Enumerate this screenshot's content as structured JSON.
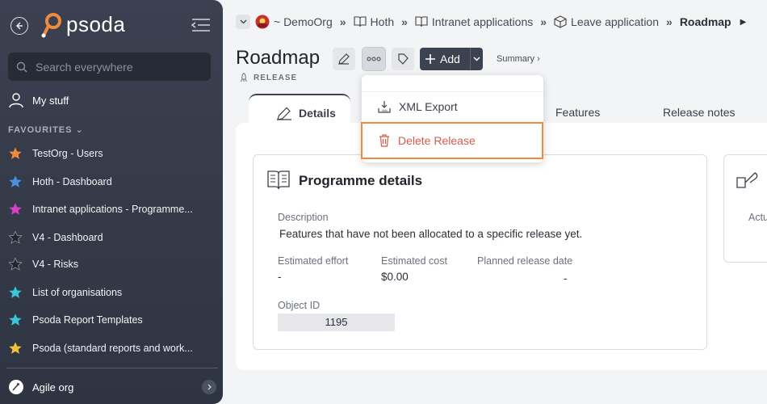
{
  "sidebar": {
    "logo_text": "psoda",
    "search_placeholder": "Search everywhere",
    "my_stuff": "My stuff",
    "favourites_heading": "FAVOURITES",
    "items": [
      {
        "label": "TestOrg - Users",
        "color": "#f08a3c"
      },
      {
        "label": "Hoth - Dashboard",
        "color": "#4a90e2"
      },
      {
        "label": "Intranet applications - Programme...",
        "color": "#d63fc8"
      },
      {
        "label": "V4 - Dashboard",
        "color": "#2b2f38"
      },
      {
        "label": "V4 - Risks",
        "color": "#2b2f38"
      },
      {
        "label": "List of organisations",
        "color": "#3cc4d8"
      },
      {
        "label": "Psoda Report Templates",
        "color": "#3cc4d8"
      },
      {
        "label": "Psoda (standard reports and work...",
        "color": "#f0c23c"
      }
    ],
    "org_label": "Agile org"
  },
  "breadcrumb": {
    "items": [
      "~ DemoOrg",
      "Hoth",
      "Intranet applications",
      "Leave application",
      "Roadmap"
    ],
    "separator": "»"
  },
  "header": {
    "title": "Roadmap",
    "subtitle": "RELEASE",
    "add_label": "Add",
    "summary_link": "Summary ›"
  },
  "tabs": [
    "Details",
    "Features",
    "Release notes"
  ],
  "menu": {
    "items": [
      {
        "label": "XML Export"
      },
      {
        "label": "Delete Release"
      }
    ]
  },
  "card": {
    "title": "Programme details",
    "description_label": "Description",
    "description_value": "Features that have not been allocated to a specific release yet.",
    "effort_label": "Estimated effort",
    "effort_value": "-",
    "cost_label": "Estimated cost",
    "cost_value": "$0.00",
    "release_date_label": "Planned release date",
    "release_date_value": "-",
    "objid_label": "Object ID",
    "objid_value": "1195"
  },
  "card2": {
    "label": "Actu"
  },
  "colors": {
    "sidebar_bg": "#353a48",
    "accent_dark": "#3c4250",
    "focus_outline": "#f08a3c",
    "danger": "#d45b4c"
  }
}
